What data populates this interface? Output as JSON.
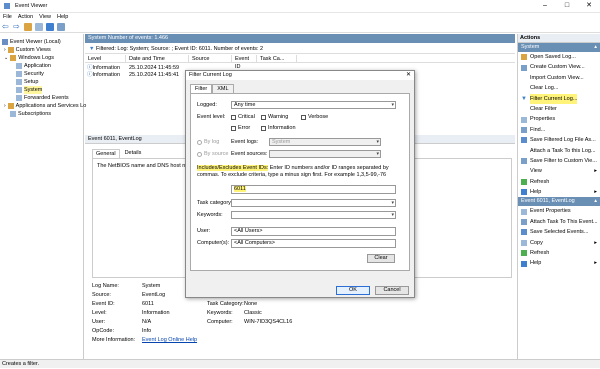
{
  "app": {
    "title": "Event Viewer",
    "colors": {
      "header_blue": "#6a8fb5",
      "highlight": "#fff37a"
    }
  },
  "window_controls": {
    "minimize": "–",
    "maximize": "□",
    "close": "✕"
  },
  "menu": [
    "File",
    "Action",
    "View",
    "Help"
  ],
  "tree": {
    "items": [
      {
        "label": "Event Viewer (Local)"
      },
      {
        "label": "Custom Views"
      },
      {
        "label": "Windows Logs"
      },
      {
        "label": "Application"
      },
      {
        "label": "Security"
      },
      {
        "label": "Setup"
      },
      {
        "label": "System"
      },
      {
        "label": "Forwarded Events"
      },
      {
        "label": "Applications and Services Lo"
      },
      {
        "label": "Subscriptions"
      }
    ]
  },
  "center": {
    "header": "System   Number of events: 1.466",
    "filter_text": "Filtered: Log: System; Source: ; Event ID: 6011. Number of events: 2",
    "columns": [
      "Level",
      "Date and Time",
      "Source",
      "Event ID",
      "Task Ca..."
    ],
    "rows": [
      {
        "level": "Information",
        "date": "25.10.2024 11:45:59"
      },
      {
        "level": "Information",
        "date": "25.10.2024 11:45:41"
      }
    ],
    "detail_header": "Event 6011, EventLog",
    "tabs": [
      "General",
      "Details"
    ],
    "message": "The NetBIOS name and DNS host name",
    "props": {
      "log_name_k": "Log Name:",
      "log_name_v": "System",
      "source_k": "Source:",
      "source_v": "EventLog",
      "event_id_k": "Event ID:",
      "event_id_v": "6011",
      "task_k": "Task Category:",
      "task_v": "None",
      "level_k": "Level:",
      "level_v": "Information",
      "keywords_k": "Keywords:",
      "keywords_v": "Classic",
      "user_k": "User:",
      "user_v": "N/A",
      "computer_k": "Computer:",
      "computer_v": "WIN-7ID3QS4CL16",
      "opcode_k": "OpCode:",
      "opcode_v": "Info",
      "more_k": "More Information:",
      "more_v": "Event Log Online Help"
    }
  },
  "dialog": {
    "title": "Filter Current Log",
    "close": "✕",
    "tabs": [
      "Filter",
      "XML"
    ],
    "logged_label": "Logged:",
    "logged_value": "Any time",
    "event_level_label": "Event level:",
    "levels": [
      "Critical",
      "Warning",
      "Verbose",
      "Error",
      "Information"
    ],
    "by_log": "By log",
    "event_logs_label": "Event logs:",
    "event_logs_value": "System",
    "by_source": "By source",
    "event_sources_label": "Event sources:",
    "hint_highlight": "Includes/Excludes Event IDs:",
    "hint_rest": " Enter ID numbers and/or ID ranges separated by commas. To exclude criteria, type a minus sign first. For example 1,3,5-99,-76",
    "event_id_value": "6011",
    "task_category_label": "Task category:",
    "keywords_label": "Keywords:",
    "user_label": "User:",
    "user_value": "<All Users>",
    "computers_label": "Computer(s):",
    "computers_value": "<All Computers>",
    "clear": "Clear",
    "ok": "OK",
    "cancel": "Cancel"
  },
  "actions": {
    "header": "Actions",
    "section1": "System",
    "items1": [
      "Open Saved Log...",
      "Create Custom View...",
      "Import Custom View...",
      "Clear Log...",
      "Filter Current Log...",
      "Clear Filter",
      "Properties",
      "Find...",
      "Save Filtered Log File As...",
      "Attach a Task To this Log...",
      "Save Filter to Custom Vie...",
      "View",
      "Refresh",
      "Help"
    ],
    "section2": "Event 6011, EventLog",
    "items2": [
      "Event Properties",
      "Attach Task To This Event...",
      "Save Selected Events...",
      "Copy",
      "Refresh",
      "Help"
    ]
  },
  "status": "Creates a filter."
}
